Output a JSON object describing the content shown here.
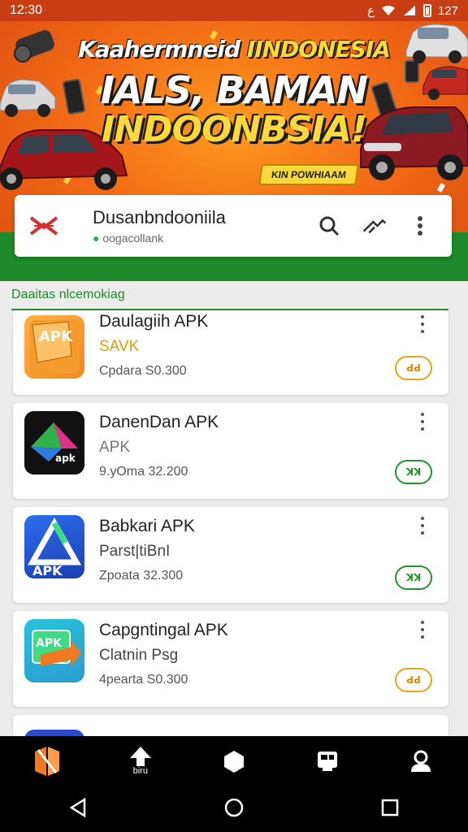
{
  "status": {
    "time": "12:30",
    "battery": "127"
  },
  "banner": {
    "line1_white": "Kaahermneid",
    "line1_yellow": "IINDONESIA",
    "line2": "IALS, BAMAN",
    "line3": "INDOONBSIA!",
    "tag": "KIN POWHIAAM"
  },
  "search_card": {
    "title": "Dusanbndooniila",
    "subtitle": "oogacollank"
  },
  "section": {
    "label": "Daaitas nlcemokiag"
  },
  "apps": [
    {
      "name": "Daulagiih APK",
      "sub": "SAVK",
      "meta": "Cpdara S0.300",
      "badge": "ꓒꓒ",
      "badge_color": "orange",
      "icon": "apk-box-orange-icon"
    },
    {
      "name": "DanenDan APK",
      "sub": "APK",
      "meta": "9.yOma 32.200",
      "badge": "ꓘꓘ",
      "badge_color": "green",
      "icon": "apk-prism-dark-icon"
    },
    {
      "name": "Babkari APK",
      "sub": "Parst|tiBnI",
      "meta": "Zpoata 32.300",
      "badge": "ꓘꓘ",
      "badge_color": "green",
      "icon": "apk-triangle-blue-icon"
    },
    {
      "name": "Capgntingal APK",
      "sub": "Clatnin Psg",
      "meta": "4pearta S0.300",
      "badge": "ꓒꓒ",
      "badge_color": "orange",
      "icon": "apk-arrow-cyan-icon"
    },
    {
      "name": "",
      "sub": "",
      "meta": "",
      "badge": "",
      "badge_color": "",
      "icon": "apk-blue-icon"
    }
  ],
  "bottom_nav": {
    "items": [
      {
        "icon": "brand-logo-icon",
        "label": ""
      },
      {
        "icon": "upload-icon",
        "label": "biru"
      },
      {
        "icon": "hexagon-icon",
        "label": ""
      },
      {
        "icon": "device-icon",
        "label": ""
      },
      {
        "icon": "profile-icon",
        "label": ""
      }
    ]
  },
  "colors": {
    "accent_green": "#1e8a2a",
    "banner_orange": "#f26a15",
    "badge_orange": "#e9a419"
  }
}
